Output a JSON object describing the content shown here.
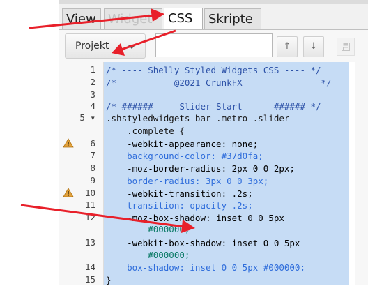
{
  "tabs": [
    {
      "label": "View",
      "state": "normal"
    },
    {
      "label": "Widget",
      "state": "dim"
    },
    {
      "label": "CSS",
      "state": "active"
    },
    {
      "label": "Skripte",
      "state": "normal"
    }
  ],
  "toolbar": {
    "select_label": "Projekt",
    "name_value": "",
    "up_symbol": "↑",
    "down_symbol": "↓",
    "save_icon": "save-icon"
  },
  "editor": {
    "lines": [
      {
        "num": "1",
        "text": "/* ---- Shelly Styled Widgets CSS ---- */",
        "kind": "comment"
      },
      {
        "num": "2",
        "text": "/*           @2021 CrunkFX               */",
        "kind": "comment"
      },
      {
        "num": "3",
        "text": "",
        "kind": "plain"
      },
      {
        "num": "4",
        "text": "/* ######     Slider Start      ###### */",
        "kind": "comment"
      },
      {
        "num": "5 ▾",
        "text": ".shstyledwidgets-bar .metro .slider",
        "kind": "selector"
      },
      {
        "num": "",
        "text": "    .complete {",
        "kind": "selector"
      },
      {
        "num": "6",
        "text": "    -webkit-appearance: none;",
        "kind": "decl",
        "warning": true
      },
      {
        "num": "7",
        "text": "    background-color: #37d0fa;",
        "kind": "decl2"
      },
      {
        "num": "8",
        "text": "    -moz-border-radius: 2px 0 0 2px;",
        "kind": "decl"
      },
      {
        "num": "9",
        "text": "    border-radius: 3px 0 0 3px;",
        "kind": "decl2"
      },
      {
        "num": "10",
        "text": "    -webkit-transition: .2s;",
        "kind": "decl",
        "warning": true
      },
      {
        "num": "11",
        "text": "    transition: opacity .2s;",
        "kind": "decl2"
      },
      {
        "num": "12",
        "text": "    -moz-box-shadow: inset 0 0 5px",
        "kind": "decl"
      },
      {
        "num": "",
        "text": "        #000000;",
        "kind": "value"
      },
      {
        "num": "13",
        "text": "    -webkit-box-shadow: inset 0 0 5px",
        "kind": "decl"
      },
      {
        "num": "",
        "text": "        #000000;",
        "kind": "value"
      },
      {
        "num": "14",
        "text": "    box-shadow: inset 0 0 5px #000000;",
        "kind": "decl2"
      },
      {
        "num": "15",
        "text": "}",
        "kind": "plain"
      }
    ]
  },
  "colors": {
    "selection": "#c6dcf5",
    "arrow": "#e8202a",
    "warning": "#e3a23c"
  }
}
